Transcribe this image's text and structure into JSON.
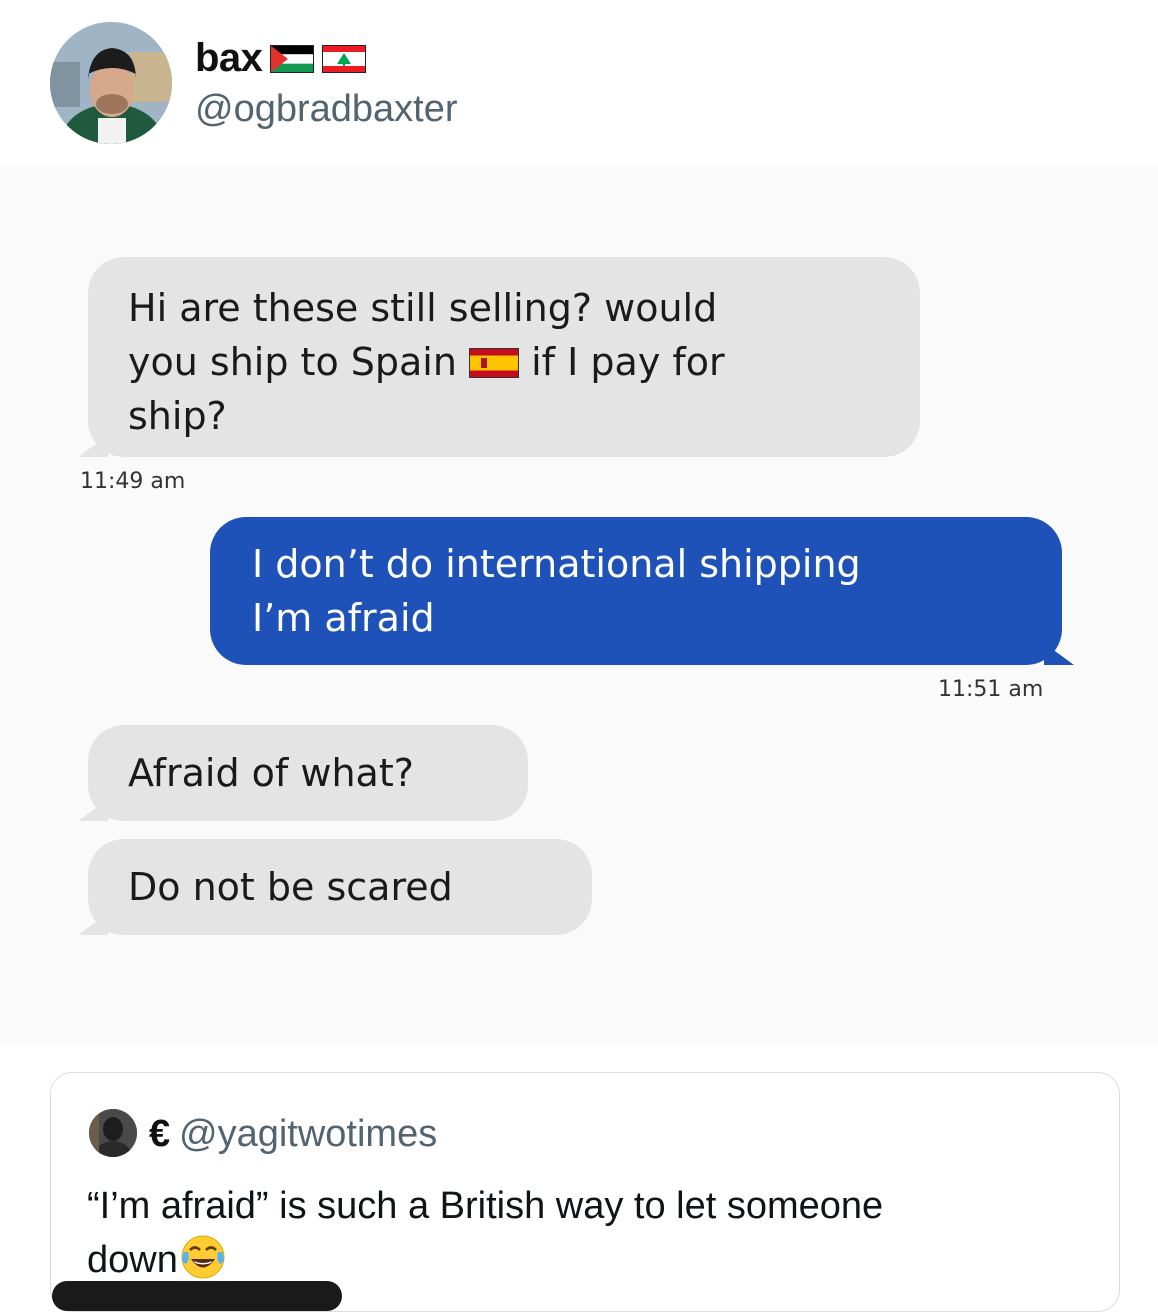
{
  "tweet": {
    "author_name": "bax",
    "author_handle": "@ogbradbaxter"
  },
  "messages": [
    {
      "line1": "Hi are these still selling? would",
      "line2a": "you ship to Spain",
      "line2b": "if I pay for",
      "line3": "ship?",
      "time": "11:49 am"
    },
    {
      "line1": "I don’t do international shipping",
      "line2": "I’m afraid",
      "time": "11:51 am"
    },
    {
      "text": "Afraid of what?"
    },
    {
      "text": "Do not be scared"
    }
  ],
  "quote": {
    "author_name": "€",
    "author_handle": "@yagitwotimes",
    "text_line1": "“I’m afraid” is such a British way to let someone",
    "text_line2": "down"
  },
  "icons": {
    "flag_1": "palestine-flag-icon",
    "flag_2": "lebanon-flag-icon",
    "inline_flag": "spain-flag-icon",
    "emoji": "face-with-tears-of-joy-icon"
  },
  "colors": {
    "outgoing_bubble": "#1f52b8",
    "incoming_bubble": "#e4e4e4",
    "handle_gray": "#536471"
  }
}
